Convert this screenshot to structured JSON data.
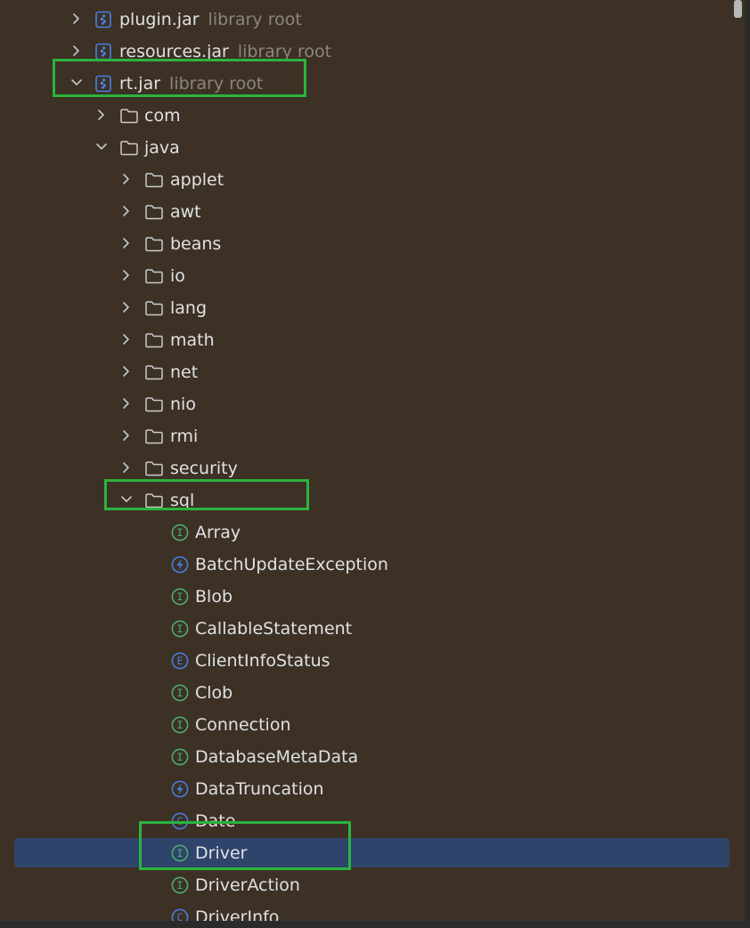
{
  "colors": {
    "background": "#3c3124",
    "selection": "#2f446b",
    "highlight_box": "#2bb33d",
    "text": "#dfe1e5",
    "hint": "#8c857b",
    "interface_icon": "#4fb06f",
    "exception_icon": "#4b7ee6",
    "enum_icon": "#4b7ee6",
    "class_icon": "#4b7ee6",
    "jar_icon": "#4b7ee6"
  },
  "tree": {
    "jars": [
      {
        "name": "plugin.jar",
        "hint": "library root",
        "expanded": false,
        "icon": "jar-icon"
      },
      {
        "name": "resources.jar",
        "hint": "library root",
        "expanded": false,
        "icon": "jar-icon"
      },
      {
        "name": "rt.jar",
        "hint": "library root",
        "expanded": true,
        "icon": "jar-icon"
      }
    ],
    "rt_children": [
      {
        "name": "com",
        "expanded": false,
        "icon": "folder-icon"
      },
      {
        "name": "java",
        "expanded": true,
        "icon": "folder-icon"
      }
    ],
    "java_packages": [
      {
        "name": "applet",
        "expanded": false
      },
      {
        "name": "awt",
        "expanded": false
      },
      {
        "name": "beans",
        "expanded": false
      },
      {
        "name": "io",
        "expanded": false
      },
      {
        "name": "lang",
        "expanded": false
      },
      {
        "name": "math",
        "expanded": false
      },
      {
        "name": "net",
        "expanded": false
      },
      {
        "name": "nio",
        "expanded": false
      },
      {
        "name": "rmi",
        "expanded": false
      },
      {
        "name": "security",
        "expanded": false
      },
      {
        "name": "sql",
        "expanded": true
      }
    ],
    "sql_members": [
      {
        "name": "Array",
        "kind": "interface",
        "icon": "interface-icon"
      },
      {
        "name": "BatchUpdateException",
        "kind": "exception",
        "icon": "exception-icon"
      },
      {
        "name": "Blob",
        "kind": "interface",
        "icon": "interface-icon"
      },
      {
        "name": "CallableStatement",
        "kind": "interface",
        "icon": "interface-icon"
      },
      {
        "name": "ClientInfoStatus",
        "kind": "enum",
        "icon": "enum-icon"
      },
      {
        "name": "Clob",
        "kind": "interface",
        "icon": "interface-icon"
      },
      {
        "name": "Connection",
        "kind": "interface",
        "icon": "interface-icon"
      },
      {
        "name": "DatabaseMetaData",
        "kind": "interface",
        "icon": "interface-icon"
      },
      {
        "name": "DataTruncation",
        "kind": "exception",
        "icon": "exception-icon"
      },
      {
        "name": "Date",
        "kind": "class",
        "icon": "class-icon"
      },
      {
        "name": "Driver",
        "kind": "interface",
        "icon": "interface-icon",
        "selected": true
      },
      {
        "name": "DriverAction",
        "kind": "interface",
        "icon": "interface-icon"
      },
      {
        "name": "DriverInfo",
        "kind": "class",
        "icon": "class-icon"
      }
    ]
  }
}
